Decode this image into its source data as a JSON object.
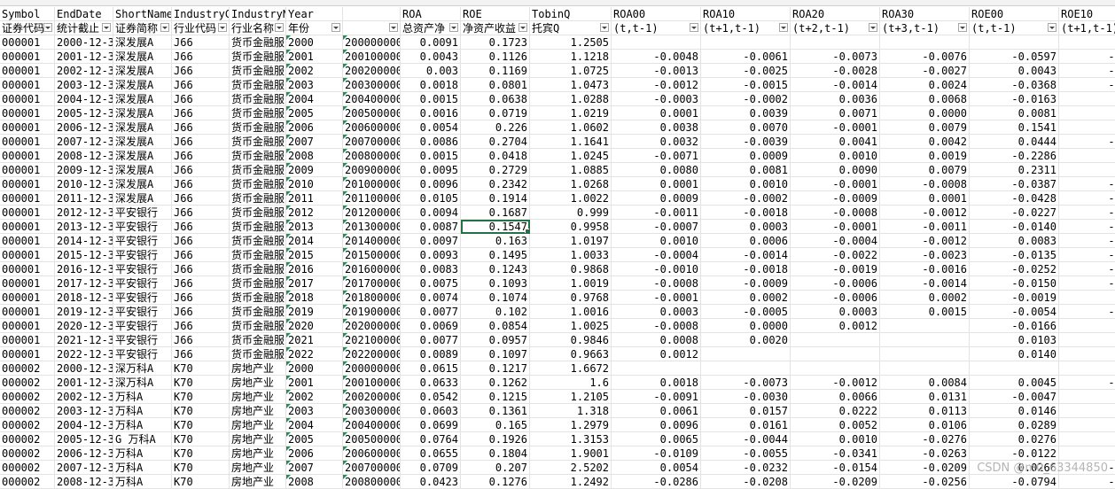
{
  "columns": [
    {
      "name": "Symbol",
      "label": "证券代码"
    },
    {
      "name": "EndDate",
      "label": "统计截止"
    },
    {
      "name": "ShortName",
      "label": "证券简称"
    },
    {
      "name": "IndustryC",
      "label": "行业代码"
    },
    {
      "name": "IndustryN",
      "label": "行业名称"
    },
    {
      "name": "Year",
      "label": "年份"
    },
    {
      "name": "",
      "label": ""
    },
    {
      "name": "ROA",
      "label": "总资产净"
    },
    {
      "name": "ROE",
      "label": "净资产收益"
    },
    {
      "name": "TobinQ",
      "label": "托宾Q"
    },
    {
      "name": "ROA00",
      "label": "(t,t-1)"
    },
    {
      "name": "ROA10",
      "label": "(t+1,t-1)"
    },
    {
      "name": "ROA20",
      "label": "(t+2,t-1)"
    },
    {
      "name": "ROA30",
      "label": "(t+3,t-1)"
    },
    {
      "name": "ROE00",
      "label": "(t,t-1)"
    },
    {
      "name": "ROE10",
      "label": "(t+1,t-1)"
    }
  ],
  "rows": [
    [
      "000001",
      "2000-12-3",
      "深发展A",
      "J66",
      "货币金融服",
      "2000",
      "200000000",
      "0.0091",
      "0.1723",
      "1.2505",
      "",
      "",
      "",
      "",
      "",
      ""
    ],
    [
      "000001",
      "2001-12-3",
      "深发展A",
      "J66",
      "货币金融服",
      "2001",
      "200100000",
      "0.0043",
      "0.1126",
      "1.1218",
      "-0.0048",
      "-0.0061",
      "-0.0073",
      "-0.0076",
      "-0.0597",
      "-0."
    ],
    [
      "000001",
      "2002-12-3",
      "深发展A",
      "J66",
      "货币金融服",
      "2002",
      "200200000",
      "0.003",
      "0.1169",
      "1.0725",
      "-0.0013",
      "-0.0025",
      "-0.0028",
      "-0.0027",
      "0.0043",
      "-0."
    ],
    [
      "000001",
      "2003-12-3",
      "深发展A",
      "J66",
      "货币金融服",
      "2003",
      "200300000",
      "0.0018",
      "0.0801",
      "1.0473",
      "-0.0012",
      "-0.0015",
      "-0.0014",
      "0.0024",
      "-0.0368",
      "-0."
    ],
    [
      "000001",
      "2004-12-3",
      "深发展A",
      "J66",
      "货币金融服",
      "2004",
      "200400000",
      "0.0015",
      "0.0638",
      "1.0288",
      "-0.0003",
      "-0.0002",
      "0.0036",
      "0.0068",
      "-0.0163",
      "0."
    ],
    [
      "000001",
      "2005-12-3",
      "深发展A",
      "J66",
      "货币金融服",
      "2005",
      "200500000",
      "0.0016",
      "0.0719",
      "1.0219",
      "0.0001",
      "0.0039",
      "0.0071",
      "0.0000",
      "0.0081",
      "0."
    ],
    [
      "000001",
      "2006-12-3",
      "深发展A",
      "J66",
      "货币金融服",
      "2006",
      "200600000",
      "0.0054",
      "0.226",
      "1.0602",
      "0.0038",
      "0.0070",
      "-0.0001",
      "0.0079",
      "0.1541",
      "0."
    ],
    [
      "000001",
      "2007-12-3",
      "深发展A",
      "J66",
      "货币金融服",
      "2007",
      "200700000",
      "0.0086",
      "0.2704",
      "1.1641",
      "0.0032",
      "-0.0039",
      "0.0041",
      "0.0042",
      "0.0444",
      "-0."
    ],
    [
      "000001",
      "2008-12-3",
      "深发展A",
      "J66",
      "货币金融服",
      "2008",
      "200800000",
      "0.0015",
      "0.0418",
      "1.0245",
      "-0.0071",
      "0.0009",
      "0.0010",
      "0.0019",
      "-0.2286",
      "0."
    ],
    [
      "000001",
      "2009-12-3",
      "深发展A",
      "J66",
      "货币金融服",
      "2009",
      "200900000",
      "0.0095",
      "0.2729",
      "1.0885",
      "0.0080",
      "0.0081",
      "0.0090",
      "0.0079",
      "0.2311",
      "0."
    ],
    [
      "000001",
      "2010-12-3",
      "深发展A",
      "J66",
      "货币金融服",
      "2010",
      "201000000",
      "0.0096",
      "0.2342",
      "1.0268",
      "0.0001",
      "0.0010",
      "-0.0001",
      "-0.0008",
      "-0.0387",
      "-0."
    ],
    [
      "000001",
      "2011-12-3",
      "深发展A",
      "J66",
      "货币金融服",
      "2011",
      "201100000",
      "0.0105",
      "0.1914",
      "1.0022",
      "0.0009",
      "-0.0002",
      "-0.0009",
      "0.0001",
      "-0.0428",
      "-0."
    ],
    [
      "000001",
      "2012-12-3",
      "平安银行",
      "J66",
      "货币金融服",
      "2012",
      "201200000",
      "0.0094",
      "0.1687",
      "0.999",
      "-0.0011",
      "-0.0018",
      "-0.0008",
      "-0.0012",
      "-0.0227",
      "-0."
    ],
    [
      "000001",
      "2013-12-3",
      "平安银行",
      "J66",
      "货币金融服",
      "2013",
      "201300000",
      "0.0087",
      "0.1547",
      "0.9958",
      "-0.0007",
      "0.0003",
      "-0.0001",
      "-0.0011",
      "-0.0140",
      "-0."
    ],
    [
      "000001",
      "2014-12-3",
      "平安银行",
      "J66",
      "货币金融服",
      "2014",
      "201400000",
      "0.0097",
      "0.163",
      "1.0197",
      "0.0010",
      "0.0006",
      "-0.0004",
      "-0.0012",
      "0.0083",
      "-0."
    ],
    [
      "000001",
      "2015-12-3",
      "平安银行",
      "J66",
      "货币金融服",
      "2015",
      "201500000",
      "0.0093",
      "0.1495",
      "1.0033",
      "-0.0004",
      "-0.0014",
      "-0.0022",
      "-0.0023",
      "-0.0135",
      "-0."
    ],
    [
      "000001",
      "2016-12-3",
      "平安银行",
      "J66",
      "货币金融服",
      "2016",
      "201600000",
      "0.0083",
      "0.1243",
      "0.9868",
      "-0.0010",
      "-0.0018",
      "-0.0019",
      "-0.0016",
      "-0.0252",
      "-0."
    ],
    [
      "000001",
      "2017-12-3",
      "平安银行",
      "J66",
      "货币金融服",
      "2017",
      "201700000",
      "0.0075",
      "0.1093",
      "1.0019",
      "-0.0008",
      "-0.0009",
      "-0.0006",
      "-0.0014",
      "-0.0150",
      "-0."
    ],
    [
      "000001",
      "2018-12-3",
      "平安银行",
      "J66",
      "货币金融服",
      "2018",
      "201800000",
      "0.0074",
      "0.1074",
      "0.9768",
      "-0.0001",
      "0.0002",
      "-0.0006",
      "0.0002",
      "-0.0019",
      "0."
    ],
    [
      "000001",
      "2019-12-3",
      "平安银行",
      "J66",
      "货币金融服",
      "2019",
      "201900000",
      "0.0077",
      "0.102",
      "1.0016",
      "0.0003",
      "-0.0005",
      "0.0003",
      "0.0015",
      "-0.0054",
      "-0."
    ],
    [
      "000001",
      "2020-12-3",
      "平安银行",
      "J66",
      "货币金融服",
      "2020",
      "202000000",
      "0.0069",
      "0.0854",
      "1.0025",
      "-0.0008",
      "0.0000",
      "0.0012",
      "",
      "-0.0166",
      "0."
    ],
    [
      "000001",
      "2021-12-3",
      "平安银行",
      "J66",
      "货币金融服",
      "2021",
      "202100000",
      "0.0077",
      "0.0957",
      "0.9846",
      "0.0008",
      "0.0020",
      "",
      "",
      "0.0103",
      "0."
    ],
    [
      "000001",
      "2022-12-3",
      "平安银行",
      "J66",
      "货币金融服",
      "2022",
      "202200000",
      "0.0089",
      "0.1097",
      "0.9663",
      "0.0012",
      "",
      "",
      "",
      "0.0140",
      ""
    ],
    [
      "000002",
      "2000-12-3",
      "深万科A",
      "K70",
      "房地产业",
      "2000",
      "200000000",
      "0.0615",
      "0.1217",
      "1.6672",
      "",
      "",
      "",
      "",
      "",
      ""
    ],
    [
      "000002",
      "2001-12-3",
      "深万科A",
      "K70",
      "房地产业",
      "2001",
      "200100000",
      "0.0633",
      "0.1262",
      "1.6",
      "0.0018",
      "-0.0073",
      "-0.0012",
      "0.0084",
      "0.0045",
      "-0."
    ],
    [
      "000002",
      "2002-12-3",
      "万科A",
      "K70",
      "房地产业",
      "2002",
      "200200000",
      "0.0542",
      "0.1215",
      "1.2105",
      "-0.0091",
      "-0.0030",
      "0.0066",
      "0.0131",
      "-0.0047",
      "0."
    ],
    [
      "000002",
      "2003-12-3",
      "万科A",
      "K70",
      "房地产业",
      "2003",
      "200300000",
      "0.0603",
      "0.1361",
      "1.318",
      "0.0061",
      "0.0157",
      "0.0222",
      "0.0113",
      "0.0146",
      "0."
    ],
    [
      "000002",
      "2004-12-3",
      "万科A",
      "K70",
      "房地产业",
      "2004",
      "200400000",
      "0.0699",
      "0.165",
      "1.2979",
      "0.0096",
      "0.0161",
      "0.0052",
      "0.0106",
      "0.0289",
      "0."
    ],
    [
      "000002",
      "2005-12-3",
      "G 万科A",
      "K70",
      "房地产业",
      "2005",
      "200500000",
      "0.0764",
      "0.1926",
      "1.3153",
      "0.0065",
      "-0.0044",
      "0.0010",
      "-0.0276",
      "0.0276",
      "0."
    ],
    [
      "000002",
      "2006-12-3",
      "万科A",
      "K70",
      "房地产业",
      "2006",
      "200600000",
      "0.0655",
      "0.1804",
      "1.9001",
      "-0.0109",
      "-0.0055",
      "-0.0341",
      "-0.0263",
      "-0.0122",
      "0."
    ],
    [
      "000002",
      "2007-12-3",
      "万科A",
      "K70",
      "房地产业",
      "2007",
      "200700000",
      "0.0709",
      "0.207",
      "2.5202",
      "0.0054",
      "-0.0232",
      "-0.0154",
      "-0.0209",
      "0.0266",
      "-0."
    ],
    [
      "000002",
      "2008-12-3",
      "万科A",
      "K70",
      "房地产业",
      "2008",
      "200800000",
      "0.0423",
      "0.1276",
      "1.2492",
      "-0.0286",
      "-0.0208",
      "-0.0209",
      "-0.0256",
      "-0.0794",
      "-0."
    ]
  ],
  "selected_cell": {
    "row": 13,
    "col": 8
  },
  "watermark": "CSDN @m0_63344850"
}
